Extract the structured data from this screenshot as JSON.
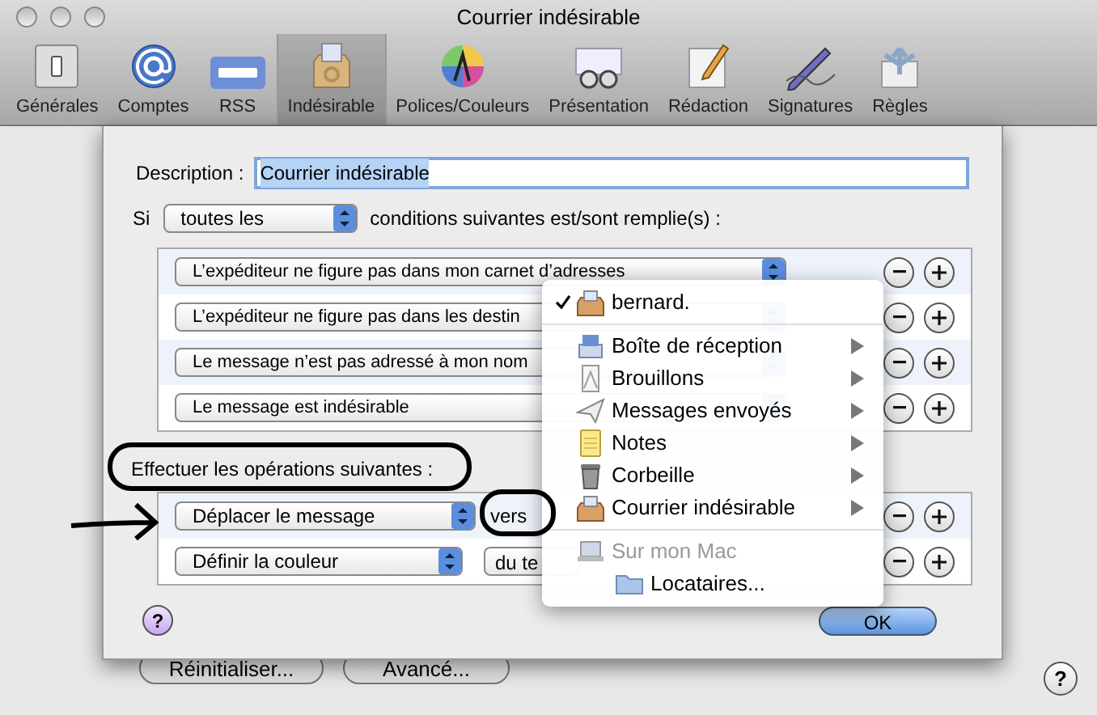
{
  "window": {
    "title": "Courrier indésirable"
  },
  "toolbar": [
    {
      "label": "Générales",
      "selected": false
    },
    {
      "label": "Comptes",
      "selected": false
    },
    {
      "label": "RSS",
      "selected": false
    },
    {
      "label": "Indésirable",
      "selected": true
    },
    {
      "label": "Polices/Couleurs",
      "selected": false
    },
    {
      "label": "Présentation",
      "selected": false
    },
    {
      "label": "Rédaction",
      "selected": false
    },
    {
      "label": "Signatures",
      "selected": false
    },
    {
      "label": "Règles",
      "selected": false
    }
  ],
  "sheet": {
    "description": {
      "label": "Description :",
      "value": "Courrier indésirable"
    },
    "match": {
      "prefix": "Si",
      "value": "toutes les",
      "suffix": "conditions suivantes est/sont remplie(s) :"
    },
    "conditions": [
      {
        "text": "L’expéditeur ne figure pas dans mon carnet d’adresses"
      },
      {
        "text": "L’expéditeur ne figure pas dans les destin"
      },
      {
        "text": "Le message n’est pas adressé à mon nom"
      },
      {
        "text": "Le message est indésirable"
      }
    ],
    "actions_label": "Effectuer les opérations suivantes :",
    "actions": [
      {
        "action": "Déplacer le message",
        "connector": "vers"
      },
      {
        "action": "Définir la couleur",
        "target": "du te"
      }
    ],
    "help": "?",
    "ok": "OK"
  },
  "menu": [
    {
      "kind": "account",
      "label": "bernard.",
      "checked": true,
      "submenu": false,
      "disabled": false
    },
    {
      "kind": "inbox",
      "label": "Boîte de réception",
      "checked": false,
      "submenu": true,
      "disabled": false
    },
    {
      "kind": "drafts",
      "label": "Brouillons",
      "checked": false,
      "submenu": true,
      "disabled": false
    },
    {
      "kind": "sent",
      "label": "Messages envoyés",
      "checked": false,
      "submenu": true,
      "disabled": false
    },
    {
      "kind": "notes",
      "label": "Notes",
      "checked": false,
      "submenu": true,
      "disabled": false
    },
    {
      "kind": "trash",
      "label": "Corbeille",
      "checked": false,
      "submenu": true,
      "disabled": false
    },
    {
      "kind": "junk",
      "label": "Courrier indésirable",
      "checked": false,
      "submenu": true,
      "disabled": false
    },
    {
      "kind": "computer",
      "label": "Sur mon Mac",
      "checked": false,
      "submenu": false,
      "disabled": true
    },
    {
      "kind": "folder",
      "label": "Locataires...",
      "checked": false,
      "submenu": false,
      "disabled": false
    }
  ],
  "footer": {
    "buttons": [
      "Réinitialiser...",
      "Avancé..."
    ],
    "help": "?"
  }
}
